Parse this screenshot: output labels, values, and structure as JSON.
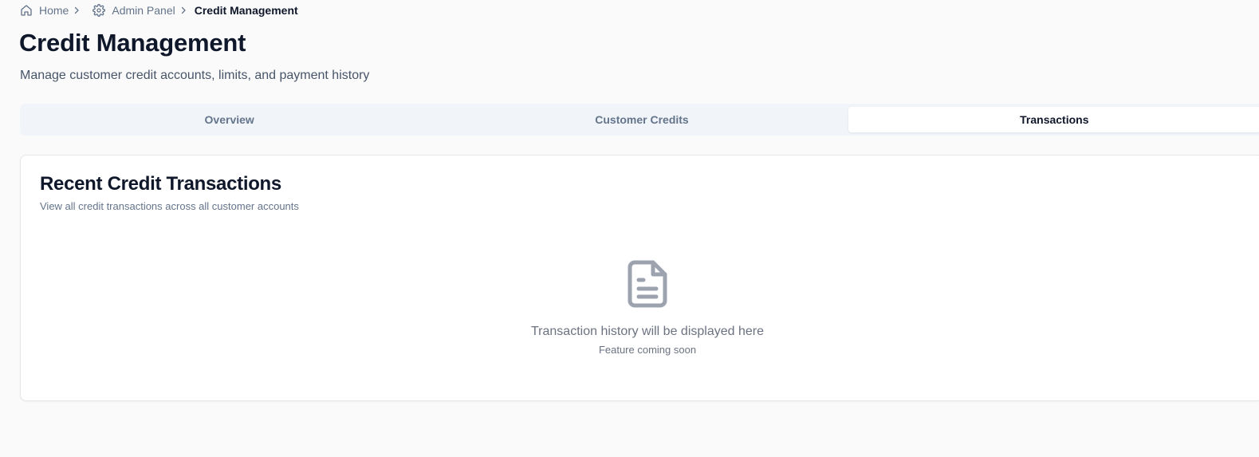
{
  "breadcrumb": {
    "items": [
      {
        "label": "Home",
        "icon": "home-icon"
      },
      {
        "label": "Admin Panel",
        "icon": "gear-icon"
      },
      {
        "label": "Credit Management"
      }
    ]
  },
  "page": {
    "title": "Credit Management",
    "subtitle": "Manage customer credit accounts, limits, and payment history"
  },
  "tabs": [
    {
      "label": "Overview",
      "active": false
    },
    {
      "label": "Customer Credits",
      "active": false
    },
    {
      "label": "Transactions",
      "active": true
    }
  ],
  "card": {
    "title": "Recent Credit Transactions",
    "description": "View all credit transactions across all customer accounts",
    "empty_state": {
      "icon": "file-text-icon",
      "title": "Transaction history will be displayed here",
      "subtitle": "Feature coming soon"
    }
  },
  "colors": {
    "background": "#fafafa",
    "text_primary": "#0f172a",
    "text_muted": "#64748b",
    "tab_bg": "#f1f5f9",
    "icon_gray": "#9ca3af"
  }
}
